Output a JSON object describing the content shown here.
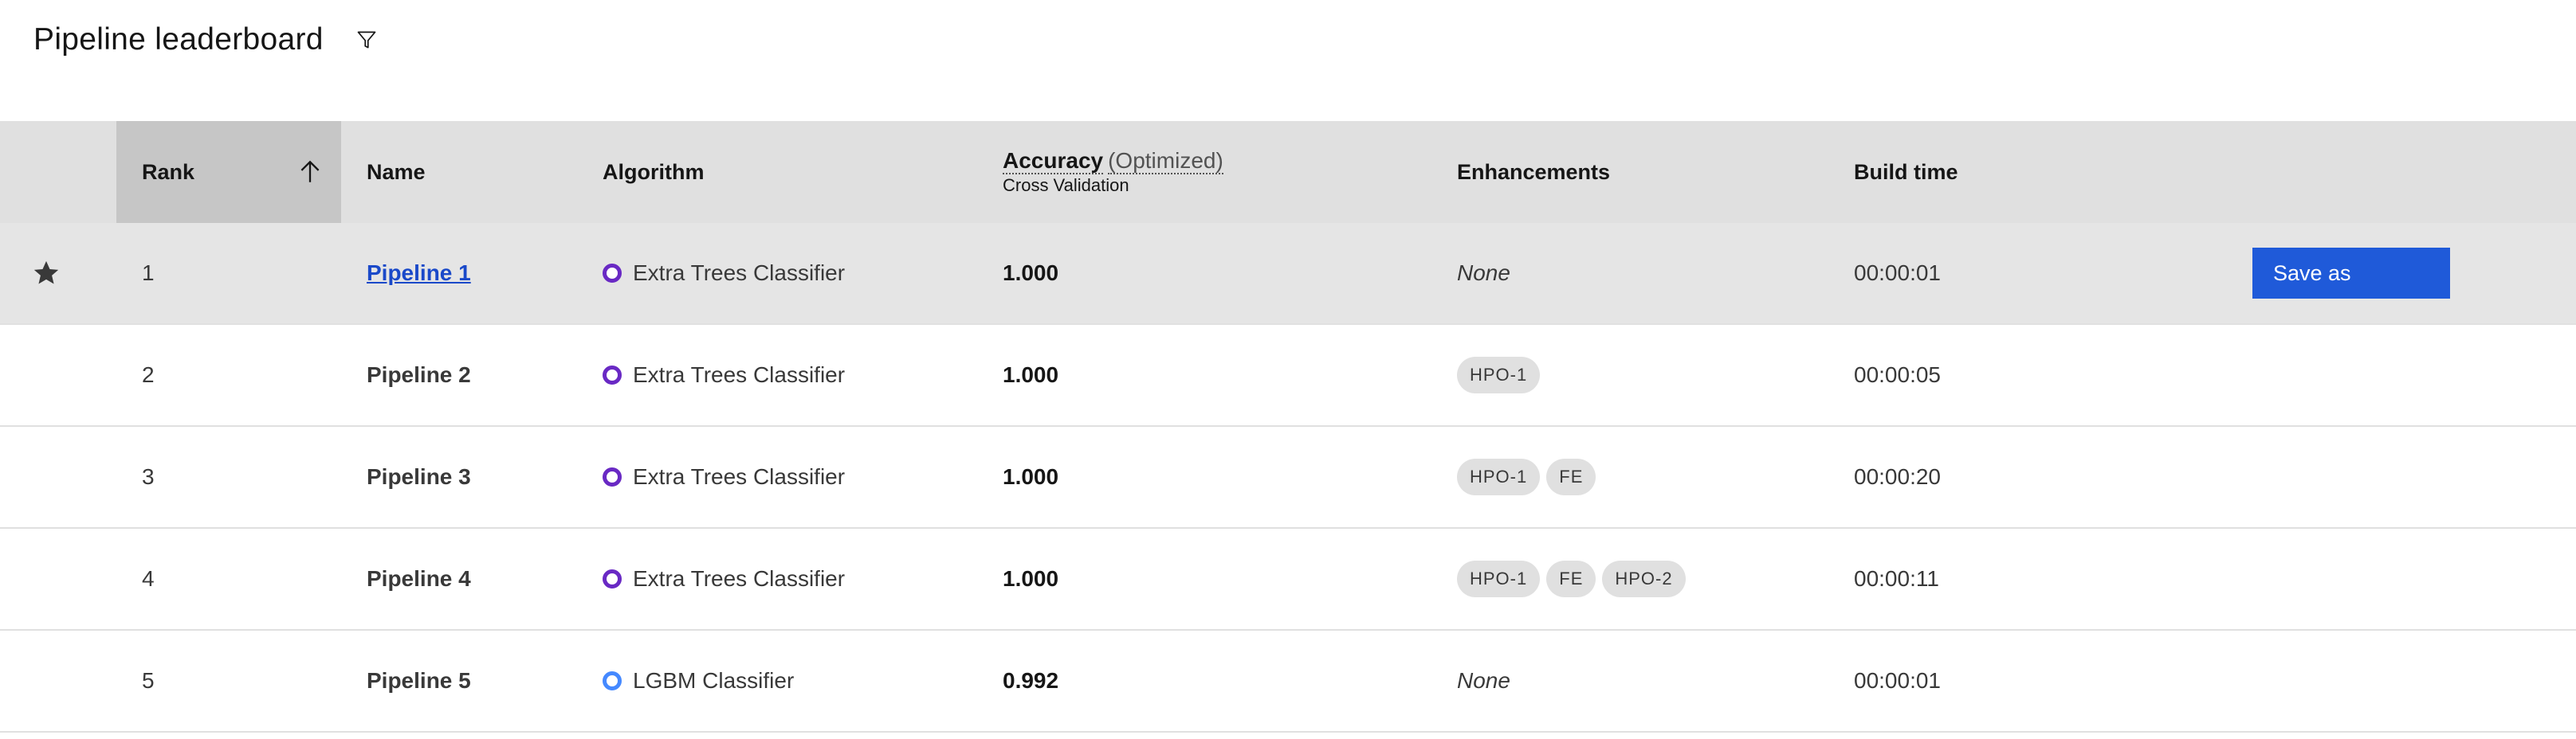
{
  "page": {
    "title": "Pipeline leaderboard",
    "filter_icon": "filter-icon"
  },
  "table": {
    "columns": {
      "rank": "Rank",
      "name": "Name",
      "algorithm": "Algorithm",
      "accuracy_metric": "Accuracy",
      "accuracy_optimized": "(Optimized)",
      "accuracy_sub": "Cross Validation",
      "enhancements": "Enhancements",
      "build_time": "Build time"
    },
    "sort_icon": "arrow-up-icon",
    "rows": [
      {
        "rank": "1",
        "name": "Pipeline 1",
        "algorithm": "Extra Trees Classifier",
        "accuracy": "1.000",
        "enhancements_text": "None",
        "tags": [],
        "build_time": "00:00:01",
        "starred": true,
        "action": "Save as"
      },
      {
        "rank": "2",
        "name": "Pipeline 2",
        "algorithm": "Extra Trees Classifier",
        "accuracy": "1.000",
        "tags": [
          "HPO-1"
        ],
        "build_time": "00:00:05"
      },
      {
        "rank": "3",
        "name": "Pipeline 3",
        "algorithm": "Extra Trees Classifier",
        "accuracy": "1.000",
        "tags": [
          "HPO-1",
          "FE"
        ],
        "build_time": "00:00:20"
      },
      {
        "rank": "4",
        "name": "Pipeline 4",
        "algorithm": "Extra Trees Classifier",
        "accuracy": "1.000",
        "tags": [
          "HPO-1",
          "FE",
          "HPO-2"
        ],
        "build_time": "00:00:11"
      },
      {
        "rank": "5",
        "name": "Pipeline 5",
        "algorithm": "LGBM Classifier",
        "accuracy": "0.992",
        "enhancements_text": "None",
        "tags": [],
        "build_time": "00:00:01"
      }
    ]
  },
  "colors": {
    "header_bg": "#e0e0e0",
    "sorted_header_bg": "#c6c6c6",
    "selected_row_bg": "#e5e5e5",
    "primary_button": "#1f5ad9",
    "extra_trees_dot": "#6929c4",
    "lgbm_dot": "#4589ff"
  }
}
